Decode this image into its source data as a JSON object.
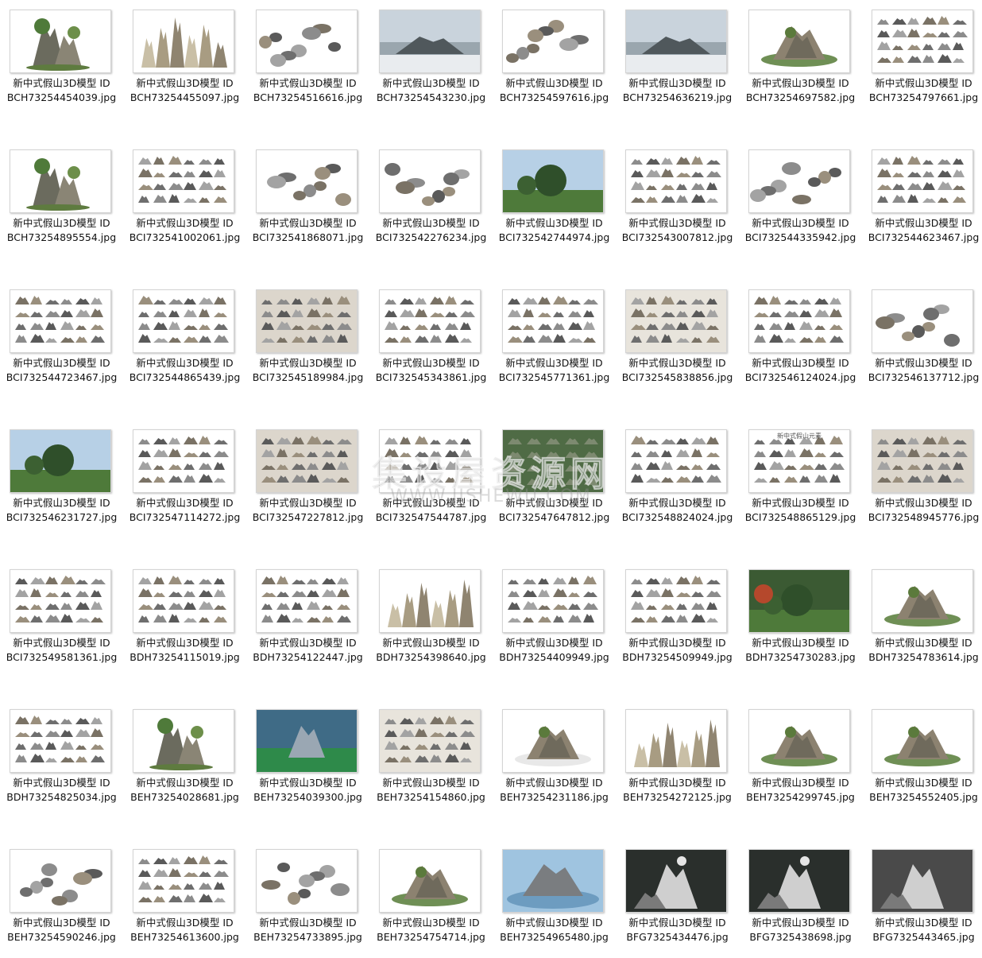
{
  "watermark": {
    "line1": "集设屋资源网",
    "line2": "WWW.JISHEWU.COM"
  },
  "files": [
    {
      "title": "新中式假山3D模型 ID",
      "file": "BCH73254454039.jpg",
      "theme": "plant"
    },
    {
      "title": "新中式假山3D模型 ID",
      "file": "BCH73254455097.jpg",
      "theme": "tall"
    },
    {
      "title": "新中式假山3D模型 ID",
      "file": "BCH73254516616.jpg",
      "theme": "scatter"
    },
    {
      "title": "新中式假山3D模型 ID",
      "file": "BCH73254543230.jpg",
      "theme": "wall"
    },
    {
      "title": "新中式假山3D模型 ID",
      "file": "BCH73254597616.jpg",
      "theme": "scatter"
    },
    {
      "title": "新中式假山3D模型 ID",
      "file": "BCH73254636219.jpg",
      "theme": "wall"
    },
    {
      "title": "新中式假山3D模型 ID",
      "file": "BCH73254697582.jpg",
      "theme": "island"
    },
    {
      "title": "新中式假山3D模型 ID",
      "file": "BCH73254797661.jpg",
      "theme": "rows"
    },
    {
      "title": "新中式假山3D模型 ID",
      "file": "BCH73254895554.jpg",
      "theme": "plant"
    },
    {
      "title": "新中式假山3D模型 ID",
      "file": "BCI732541002061.jpg",
      "theme": "rows"
    },
    {
      "title": "新中式假山3D模型 ID",
      "file": "BCI732541868071.jpg",
      "theme": "scatter"
    },
    {
      "title": "新中式假山3D模型 ID",
      "file": "BCI732542276234.jpg",
      "theme": "scatter"
    },
    {
      "title": "新中式假山3D模型 ID",
      "file": "BCI732542744974.jpg",
      "theme": "landscape"
    },
    {
      "title": "新中式假山3D模型 ID",
      "file": "BCI732543007812.jpg",
      "theme": "rows"
    },
    {
      "title": "新中式假山3D模型 ID",
      "file": "BCI732544335942.jpg",
      "theme": "scatter"
    },
    {
      "title": "新中式假山3D模型 ID",
      "file": "BCI732544623467.jpg",
      "theme": "rows"
    },
    {
      "title": "新中式假山3D模型 ID",
      "file": "BCI732544723467.jpg",
      "theme": "rows"
    },
    {
      "title": "新中式假山3D模型 ID",
      "file": "BCI732544865439.jpg",
      "theme": "rows"
    },
    {
      "title": "新中式假山3D模型 ID",
      "file": "BCI732545189984.jpg",
      "theme": "beige"
    },
    {
      "title": "新中式假山3D模型 ID",
      "file": "BCI732545343861.jpg",
      "theme": "rows"
    },
    {
      "title": "新中式假山3D模型 ID",
      "file": "BCI732545771361.jpg",
      "theme": "rows"
    },
    {
      "title": "新中式假山3D模型 ID",
      "file": "BCI732545838856.jpg",
      "theme": "shelf"
    },
    {
      "title": "新中式假山3D模型 ID",
      "file": "BCI732546124024.jpg",
      "theme": "rows"
    },
    {
      "title": "新中式假山3D模型 ID",
      "file": "BCI732546137712.jpg",
      "theme": "scatter"
    },
    {
      "title": "新中式假山3D模型 ID",
      "file": "BCI732546231727.jpg",
      "theme": "landscape"
    },
    {
      "title": "新中式假山3D模型 ID",
      "file": "BCI732547114272.jpg",
      "theme": "rows"
    },
    {
      "title": "新中式假山3D模型 ID",
      "file": "BCI732547227812.jpg",
      "theme": "beige"
    },
    {
      "title": "新中式假山3D模型 ID",
      "file": "BCI732547544787.jpg",
      "theme": "rows"
    },
    {
      "title": "新中式假山3D模型 ID",
      "file": "BCI732547647812.jpg",
      "theme": "green"
    },
    {
      "title": "新中式假山3D模型 ID",
      "file": "BCI732548824024.jpg",
      "theme": "rows"
    },
    {
      "title": "新中式假山3D模型 ID",
      "file": "BCI732548865129.jpg",
      "theme": "rows",
      "heading": "新中式假山元素"
    },
    {
      "title": "新中式假山3D模型 ID",
      "file": "BCI732548945776.jpg",
      "theme": "beige"
    },
    {
      "title": "新中式假山3D模型 ID",
      "file": "BCI732549581361.jpg",
      "theme": "rows"
    },
    {
      "title": "新中式假山3D模型 ID",
      "file": "BDH73254115019.jpg",
      "theme": "rows"
    },
    {
      "title": "新中式假山3D模型 ID",
      "file": "BDH73254122447.jpg",
      "theme": "rows"
    },
    {
      "title": "新中式假山3D模型 ID",
      "file": "BDH73254398640.jpg",
      "theme": "tall"
    },
    {
      "title": "新中式假山3D模型 ID",
      "file": "BDH73254409949.jpg",
      "theme": "rows"
    },
    {
      "title": "新中式假山3D模型 ID",
      "file": "BDH73254509949.jpg",
      "theme": "rows"
    },
    {
      "title": "新中式假山3D模型 ID",
      "file": "BDH73254730283.jpg",
      "theme": "garden"
    },
    {
      "title": "新中式假山3D模型 ID",
      "file": "BDH73254783614.jpg",
      "theme": "island"
    },
    {
      "title": "新中式假山3D模型 ID",
      "file": "BDH73254825034.jpg",
      "theme": "rows"
    },
    {
      "title": "新中式假山3D模型 ID",
      "file": "BEH73254028681.jpg",
      "theme": "plant"
    },
    {
      "title": "新中式假山3D模型 ID",
      "file": "BEH73254039300.jpg",
      "theme": "plaza"
    },
    {
      "title": "新中式假山3D模型 ID",
      "file": "BEH73254154860.jpg",
      "theme": "shelf"
    },
    {
      "title": "新中式假山3D模型 ID",
      "file": "BEH73254231186.jpg",
      "theme": "pile"
    },
    {
      "title": "新中式假山3D模型 ID",
      "file": "BEH73254272125.jpg",
      "theme": "tall"
    },
    {
      "title": "新中式假山3D模型 ID",
      "file": "BEH73254299745.jpg",
      "theme": "island"
    },
    {
      "title": "新中式假山3D模型 ID",
      "file": "BEH73254552405.jpg",
      "theme": "island"
    },
    {
      "title": "新中式假山3D模型 ID",
      "file": "BEH73254590246.jpg",
      "theme": "scatter"
    },
    {
      "title": "新中式假山3D模型 ID",
      "file": "BEH73254613600.jpg",
      "theme": "rows"
    },
    {
      "title": "新中式假山3D模型 ID",
      "file": "BEH73254733895.jpg",
      "theme": "scatter"
    },
    {
      "title": "新中式假山3D模型 ID",
      "file": "BEH73254754714.jpg",
      "theme": "island"
    },
    {
      "title": "新中式假山3D模型 ID",
      "file": "BEH73254965480.jpg",
      "theme": "pond"
    },
    {
      "title": "新中式假山3D模型 ID",
      "file": "BFG7325434476.jpg",
      "theme": "dark"
    },
    {
      "title": "新中式假山3D模型 ID",
      "file": "BFG7325438698.jpg",
      "theme": "dark"
    },
    {
      "title": "新中式假山3D模型 ID",
      "file": "BFG7325443465.jpg",
      "theme": "darkgray"
    }
  ]
}
